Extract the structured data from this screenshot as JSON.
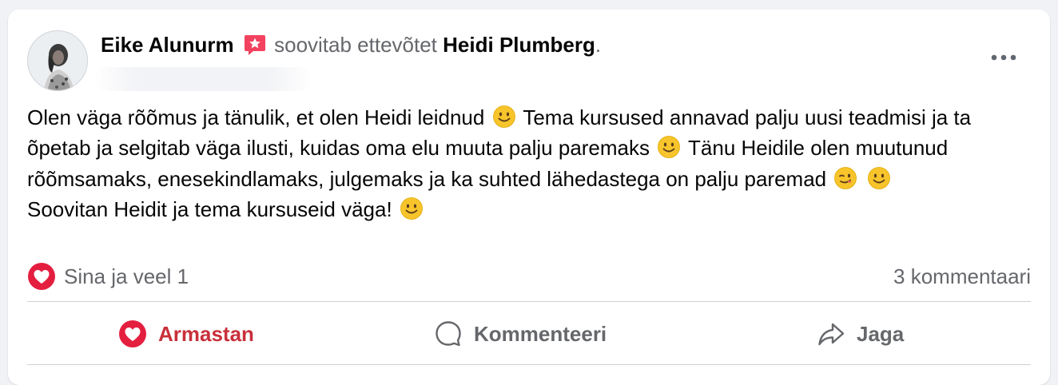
{
  "post": {
    "author_name": "Eike Alunurm",
    "recommends_text": "soovitab ettevõtet",
    "page_name": "Heidi Plumberg",
    "trailing_period": ".",
    "more_icon": "ellipsis-icon",
    "body_paragraph_1_parts": [
      "Olen väga rõõmus ja tänulik, et olen Heidi leidnud",
      "Tema kursused annavad palju uusi teadmisi ja ta õpetab ja selgitab väga ilusti, kuidas oma elu muuta palju paremaks",
      "Tänu Heidile olen muutunud rõõmsamaks, enesekindlamaks, julgemaks ja ka suhted lähedastega on palju paremad"
    ],
    "body_paragraph_2": "Soovitan Heidit ja tema kursuseid väga!"
  },
  "stats": {
    "reactions_text": "Sina ja veel 1",
    "comments_text": "3 kommentaari"
  },
  "actions": {
    "love_label": "Armastan",
    "comment_label": "Kommenteeri",
    "share_label": "Jaga"
  },
  "colors": {
    "love_red": "#e41e3f",
    "action_love_text": "#c8303a",
    "secondary_text": "#65676b",
    "primary_text": "#050505",
    "badge_pink": "#f3425f",
    "emoji_yellow": "#f7c52b"
  }
}
